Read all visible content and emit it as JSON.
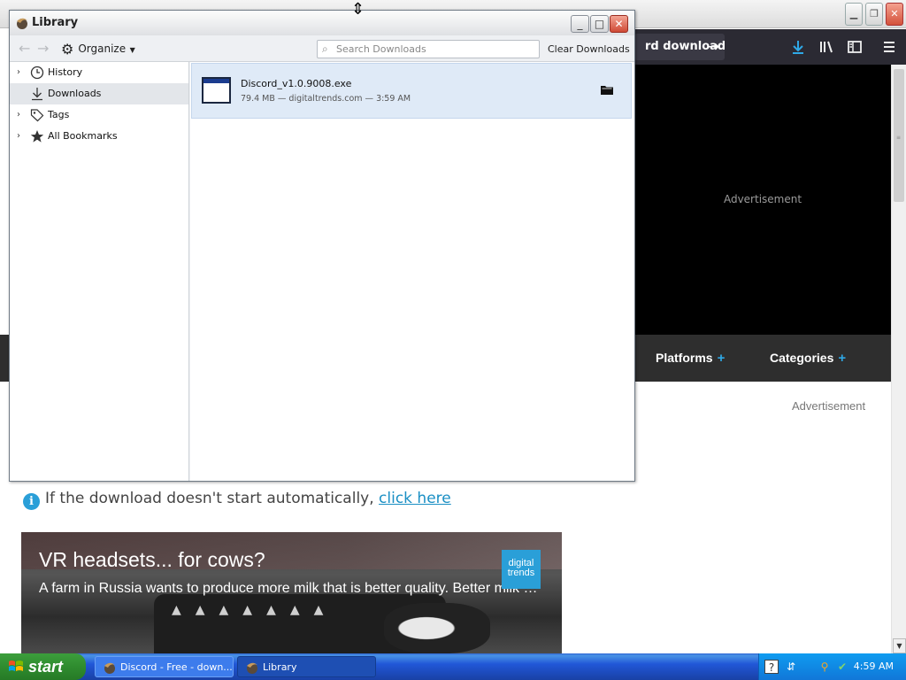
{
  "browser": {
    "download_cta": "rd download",
    "ad_top": "Advertisement",
    "nav": [
      {
        "label": "Platforms",
        "plus": "+"
      },
      {
        "label": "Categories",
        "plus": "+"
      }
    ],
    "ad_side": "Advertisement",
    "notice": {
      "text": "If the download doesn't start automatically, ",
      "link": "click here"
    },
    "promo": {
      "title": "VR headsets... for cows?",
      "subtitle": "A farm in Russia wants to produce more milk that is better quality. Better milk co...",
      "logo_line1": "digital",
      "logo_line2": "trends"
    }
  },
  "library": {
    "title": "Library",
    "toolbar": {
      "organize": "Organize",
      "search_placeholder": "Search Downloads",
      "clear": "Clear Downloads"
    },
    "sidebar": [
      {
        "label": "History",
        "icon": "clock-icon",
        "expandable": true
      },
      {
        "label": "Downloads",
        "icon": "download-icon",
        "expandable": false,
        "selected": true
      },
      {
        "label": "Tags",
        "icon": "tag-icon",
        "expandable": true
      },
      {
        "label": "All Bookmarks",
        "icon": "star-icon",
        "expandable": true
      }
    ],
    "downloads": [
      {
        "filename": "Discord_v1.0.9008.exe",
        "details": "79.4 MB — digitaltrends.com — 3:59 AM"
      }
    ]
  },
  "taskbar": {
    "start": "start",
    "tasks": [
      {
        "label": "Discord - Free - down...",
        "active": false
      },
      {
        "label": "Library",
        "active": true
      }
    ],
    "clock": "4:59 AM"
  },
  "colors": {
    "accent": "#2a9fd8",
    "selection": "#dfeaf7",
    "taskbar": "#2157d7",
    "start_green": "#2f8c2f"
  }
}
